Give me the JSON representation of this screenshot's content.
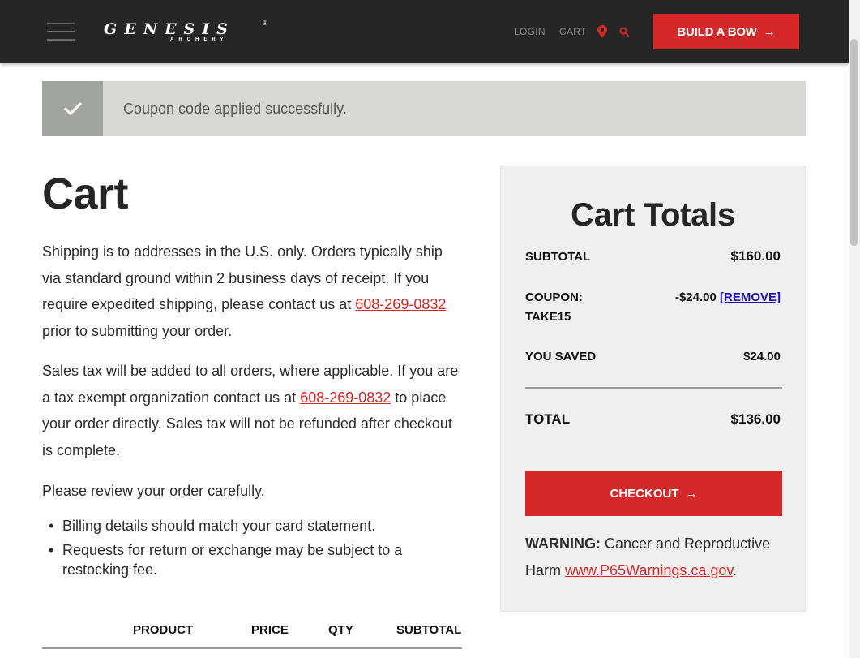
{
  "header": {
    "logo_text": "GENESIS",
    "logo_sub": "ARCHERY",
    "logo_reg": "®",
    "nav_login": "LOGIN",
    "nav_cart": "CART",
    "build_button": "BUILD A BOW",
    "arrow": "→"
  },
  "notice": {
    "message": "Coupon code applied successfully."
  },
  "page": {
    "title": "Cart",
    "shipping_text_1": "Shipping is to addresses in the U.S. only. Orders typically ship via standard ground within 2 business days of receipt. If you require expedited shipping, please contact us at ",
    "phone": "608-269-0832",
    "shipping_text_2": " prior to submitting your order.",
    "tax_text_1": "Sales tax will be added to all orders, where applicable. If you are a tax exempt organization contact us at ",
    "tax_text_2": " to place your order directly. Sales tax will not be refunded after checkout is complete.",
    "review_text": "Please review your order carefully.",
    "bullets": [
      "Billing details should match your card statement.",
      "Requests for return or exchange may be subject to a restocking fee."
    ]
  },
  "table": {
    "headers": [
      "PRODUCT",
      "PRICE",
      "QTY",
      "SUBTOTAL"
    ]
  },
  "totals": {
    "title": "Cart Totals",
    "subtotal_label": "SUBTOTAL",
    "subtotal_value": "$160.00",
    "coupon_label_1": "COUPON:",
    "coupon_label_2": "TAKE15",
    "coupon_value": "-$24.00",
    "remove_label": "[REMOVE]",
    "saved_label": "YOU SAVED",
    "saved_value": "$24.00",
    "total_label": "TOTAL",
    "total_value": "$136.00",
    "checkout_label": "CHECKOUT",
    "warning_label": "WARNING:",
    "warning_text": " Cancer and Reproductive Harm ",
    "warning_link": "www.P65Warnings.ca.gov",
    "warning_end": "."
  },
  "colors": {
    "brand_red": "#d62828",
    "header_bg": "#262626",
    "notice_bg": "#d7d8d3",
    "totals_bg": "#efefef"
  },
  "icons": [
    "hamburger-menu-icon",
    "map-pin-icon",
    "search-icon",
    "checkmark-icon",
    "arrow-right-icon"
  ]
}
